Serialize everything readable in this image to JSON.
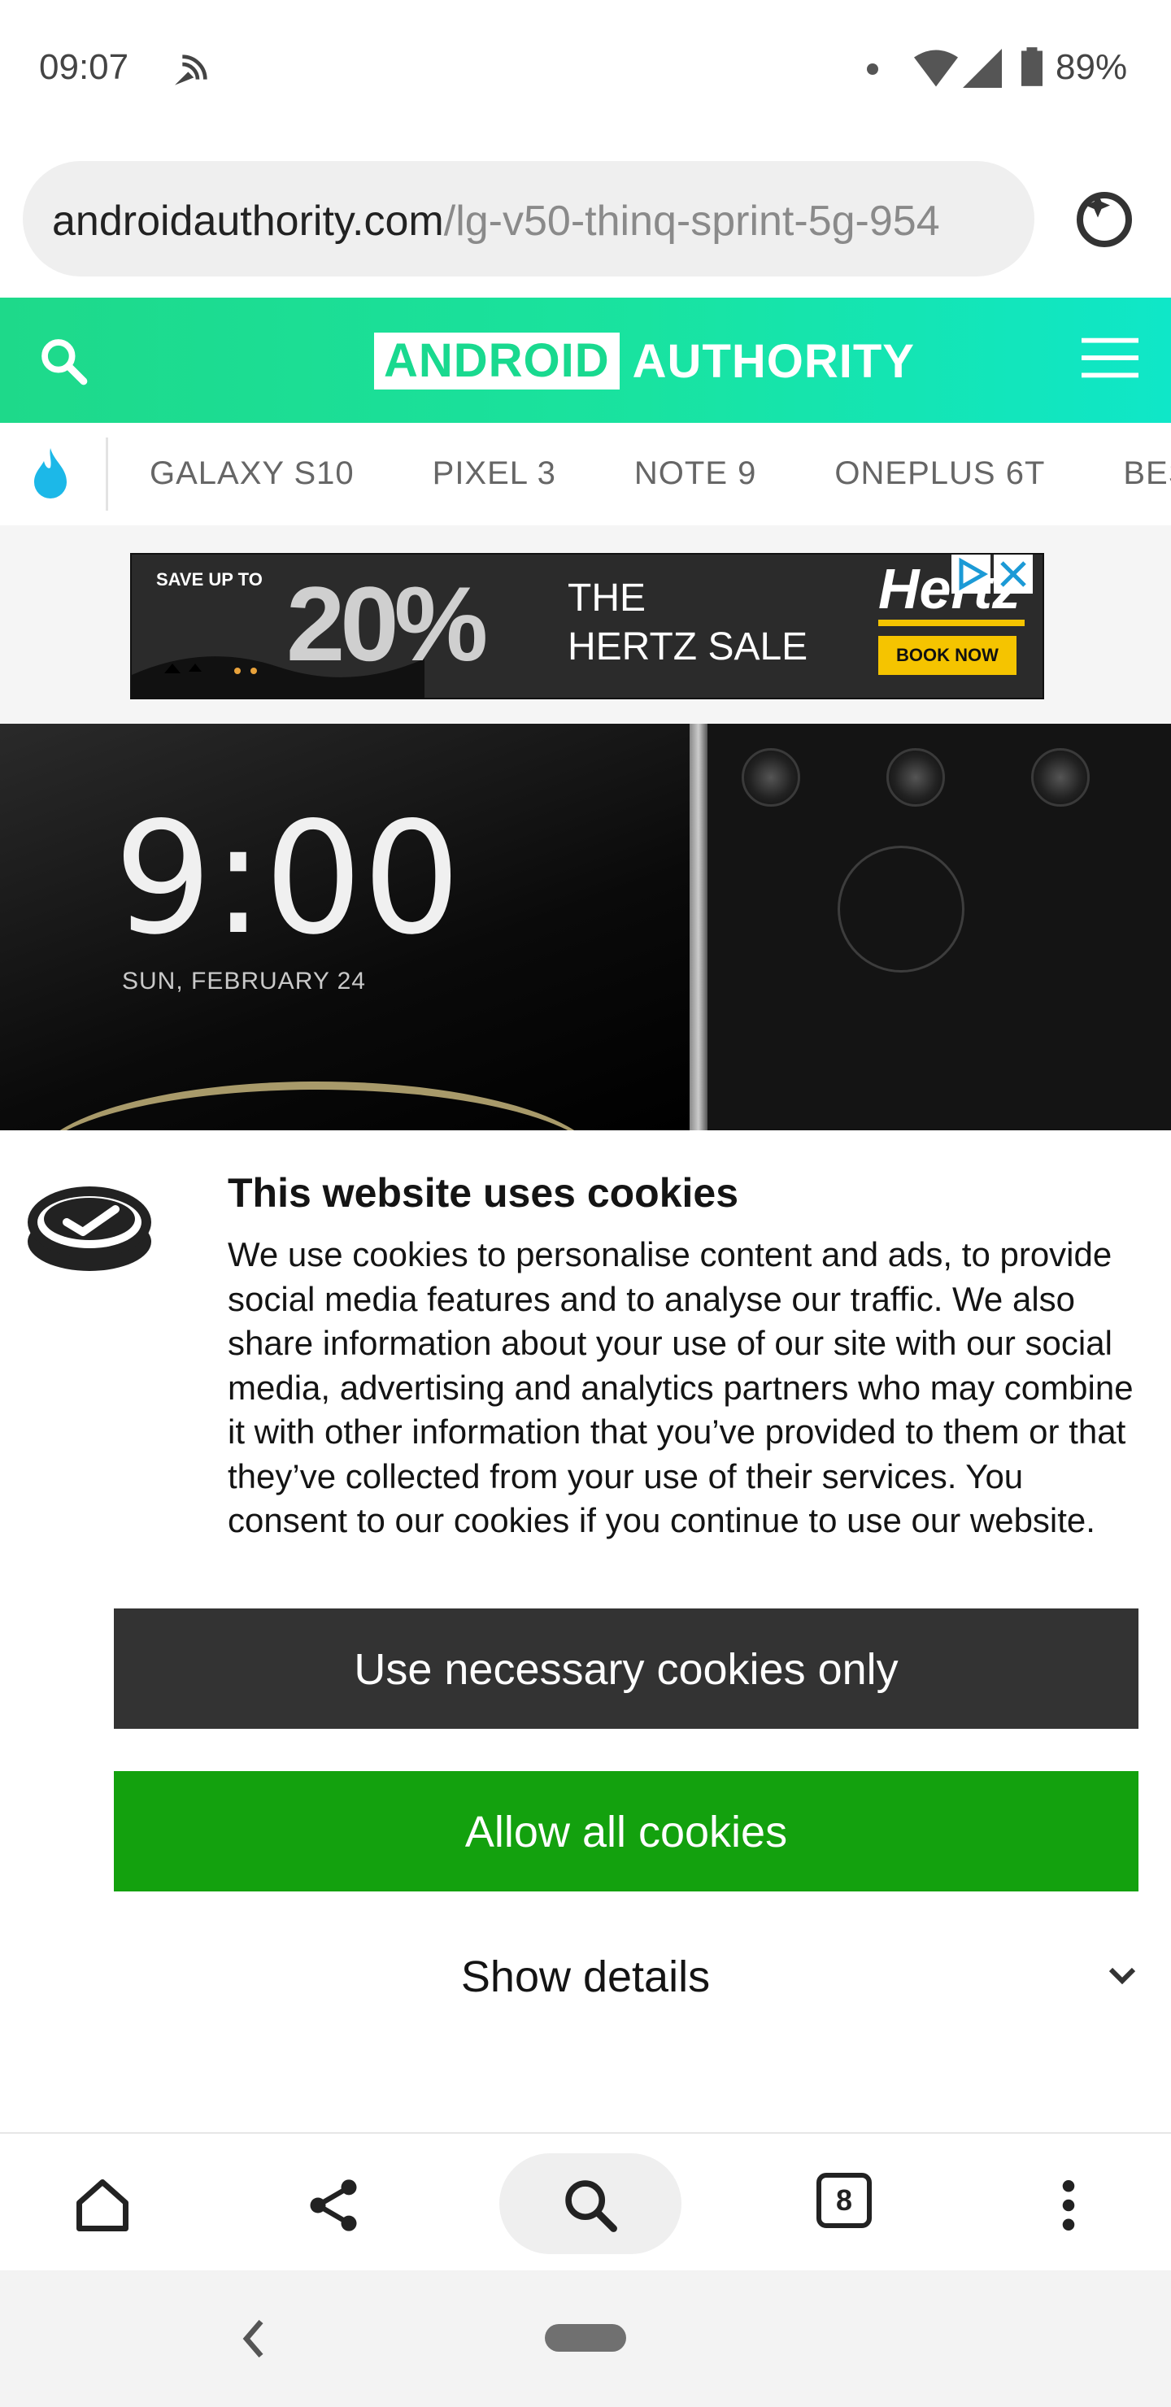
{
  "status_bar": {
    "time": "09:07",
    "battery": "89%"
  },
  "browser": {
    "url_domain": "androidauthority.com",
    "url_path": "/lg-v50-thinq-sprint-5g-954"
  },
  "site": {
    "logo_box": "ANDROID",
    "logo_text": "AUTHORITY",
    "nav_items": [
      "GALAXY S10",
      "PIXEL 3",
      "NOTE 9",
      "ONEPLUS 6T",
      "BEST"
    ]
  },
  "ad": {
    "save": "SAVE UP TO",
    "percent": "20%",
    "line1": "THE",
    "line2": "HERTZ SALE",
    "brand": "Hertz",
    "cta": "BOOK NOW"
  },
  "hero": {
    "clock": "9:00",
    "date": "SUN, FEBRUARY 24"
  },
  "cookie": {
    "title": "This website uses cookies",
    "body": "We use cookies to personalise content and ads, to provide social media features and to analyse our traffic. We also share information about your use of our site with our social media, advertising and analytics partners who may combine it with other information that you’ve provided to them or that they’ve collected from your use of their services. You consent to our cookies if you continue to use our website.",
    "necessary_label": "Use necessary cookies only",
    "allow_label": "Allow all cookies",
    "details_label": "Show details"
  },
  "toolbar": {
    "tab_count": "8"
  },
  "colors": {
    "brand_green": "#19d98f",
    "allow_button": "#13a10e",
    "necessary_button": "#333333"
  }
}
